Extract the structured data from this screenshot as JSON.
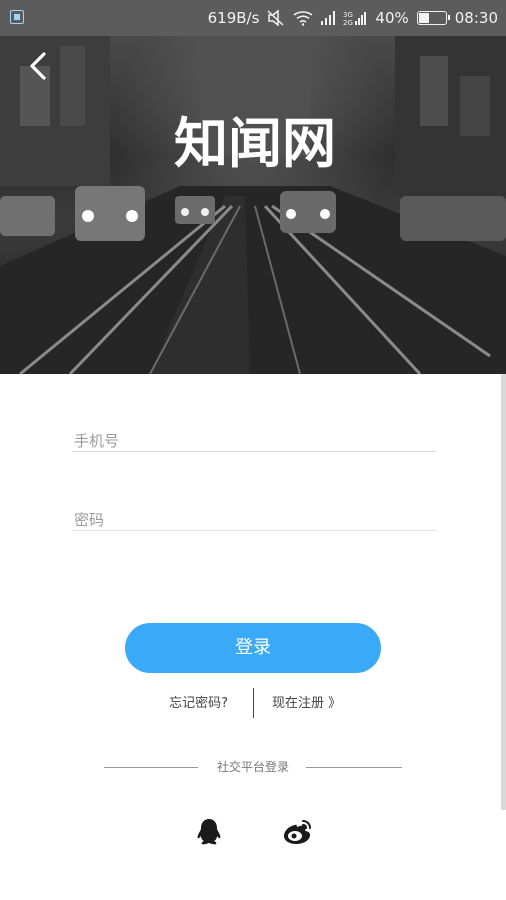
{
  "status_bar": {
    "speed": "619B/s",
    "battery_percent": "40%",
    "battery_level": 0.4,
    "time": "08:30",
    "icons": [
      "gallery-notification-icon",
      "mute-icon",
      "wifi-icon",
      "signal-icon",
      "dual-signal-icon",
      "battery-icon"
    ]
  },
  "hero": {
    "logo_text": "知闻网",
    "back_icon": "chevron-left-icon"
  },
  "form": {
    "phone_placeholder": "手机号",
    "phone_value": "",
    "password_placeholder": "密码",
    "password_value": ""
  },
  "actions": {
    "login_label": "登录",
    "forgot_label": "忘记密码?",
    "register_label": "现在注册 》"
  },
  "social": {
    "title": "社交平台登录",
    "providers": [
      "qq-icon",
      "weibo-icon"
    ]
  },
  "colors": {
    "accent": "#3aa9f7",
    "status_bar": "#5c5c5c"
  }
}
